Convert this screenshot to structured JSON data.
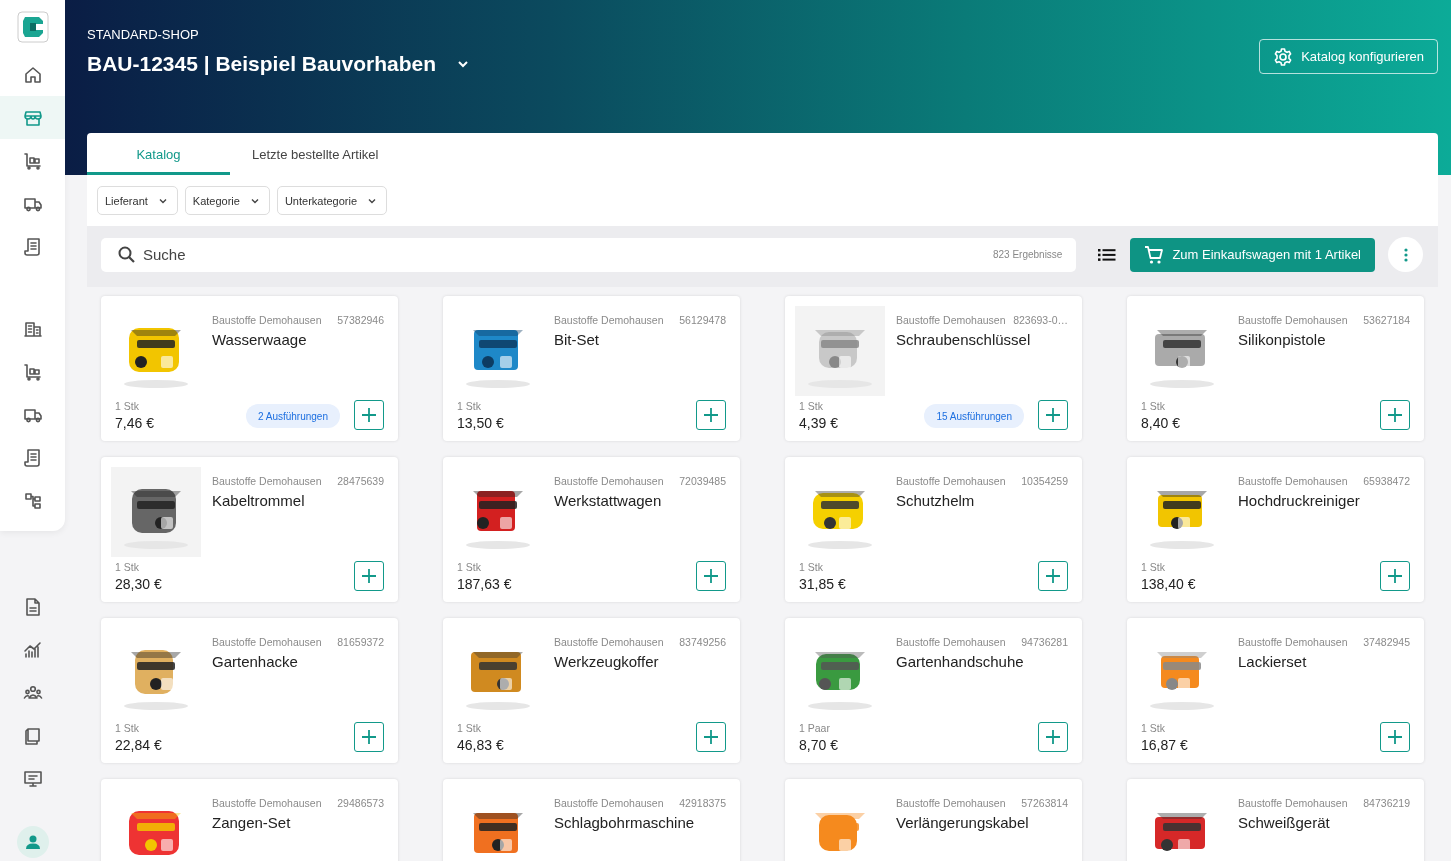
{
  "sidebar": {
    "groups": [
      {
        "items": [
          {
            "selected": false
          },
          {
            "selected": true
          },
          {
            "selected": false
          },
          {
            "selected": false
          },
          {
            "selected": false
          }
        ]
      },
      {
        "items": [
          {
            "selected": false
          },
          {
            "selected": false
          },
          {
            "selected": false
          },
          {
            "selected": false
          },
          {
            "selected": false
          }
        ]
      },
      {
        "items": [
          {
            "selected": false
          },
          {
            "selected": false
          },
          {
            "selected": false
          },
          {
            "selected": false
          },
          {
            "selected": false
          }
        ]
      }
    ]
  },
  "header": {
    "shop": "STANDARD-SHOP",
    "project": "BAU-12345 | Beispiel Bauvorhaben",
    "config_button": "Katalog konfigurieren"
  },
  "tabs": [
    {
      "label": "Katalog",
      "selected": true
    },
    {
      "label": "Letzte bestellte Artikel",
      "selected": false
    }
  ],
  "filters": [
    "Lieferant",
    "Kategorie",
    "Unterkategorie"
  ],
  "search": {
    "placeholder": "Suche",
    "results": "823 Ergebnisse"
  },
  "cart_button": "Zum Einkaufswagen mit 1 Artikel",
  "products": [
    {
      "supplier": "Baustoffe Demohausen",
      "sku": "57382946",
      "name": "Wasserwaage",
      "unit": "1 Stk",
      "price": "7,46 €",
      "variants": "2 Ausführungen"
    },
    {
      "supplier": "Baustoffe Demohausen",
      "sku": "56129478",
      "name": "Bit-Set",
      "unit": "1 Stk",
      "price": "13,50 €"
    },
    {
      "supplier": "Baustoffe Demohausen",
      "sku": "823693-0…",
      "name": "Schraubenschlüssel",
      "unit": "1 Stk",
      "price": "4,39 €",
      "variants": "15 Ausführungen"
    },
    {
      "supplier": "Baustoffe Demohausen",
      "sku": "53627184",
      "name": "Silikonpistole",
      "unit": "1 Stk",
      "price": "8,40 €"
    },
    {
      "supplier": "Baustoffe Demohausen",
      "sku": "28475639",
      "name": "Kabeltrommel",
      "unit": "1 Stk",
      "price": "28,30 €"
    },
    {
      "supplier": "Baustoffe Demohausen",
      "sku": "72039485",
      "name": "Werkstattwagen",
      "unit": "1 Stk",
      "price": "187,63 €"
    },
    {
      "supplier": "Baustoffe Demohausen",
      "sku": "10354259",
      "name": "Schutzhelm",
      "unit": "1 Stk",
      "price": "31,85 €"
    },
    {
      "supplier": "Baustoffe Demohausen",
      "sku": "65938472",
      "name": "Hochdruckreiniger",
      "unit": "1 Stk",
      "price": "138,40 €"
    },
    {
      "supplier": "Baustoffe Demohausen",
      "sku": "81659372",
      "name": "Gartenhacke",
      "unit": "1 Stk",
      "price": "22,84 €"
    },
    {
      "supplier": "Baustoffe Demohausen",
      "sku": "83749256",
      "name": "Werkzeugkoffer",
      "unit": "1 Stk",
      "price": "46,83 €"
    },
    {
      "supplier": "Baustoffe Demohausen",
      "sku": "94736281",
      "name": "Gartenhandschuhe",
      "unit": "1 Paar",
      "price": "8,70 €"
    },
    {
      "supplier": "Baustoffe Demohausen",
      "sku": "37482945",
      "name": "Lackierset",
      "unit": "1 Stk",
      "price": "16,87 €"
    },
    {
      "supplier": "Baustoffe Demohausen",
      "sku": "29486573",
      "name": "Zangen-Set"
    },
    {
      "supplier": "Baustoffe Demohausen",
      "sku": "42918375",
      "name": "Schlagbohrmaschine"
    },
    {
      "supplier": "Baustoffe Demohausen",
      "sku": "57263814",
      "name": "Verlängerungskabel"
    },
    {
      "supplier": "Baustoffe Demohausen",
      "sku": "84736219",
      "name": "Schweißgerät"
    }
  ]
}
